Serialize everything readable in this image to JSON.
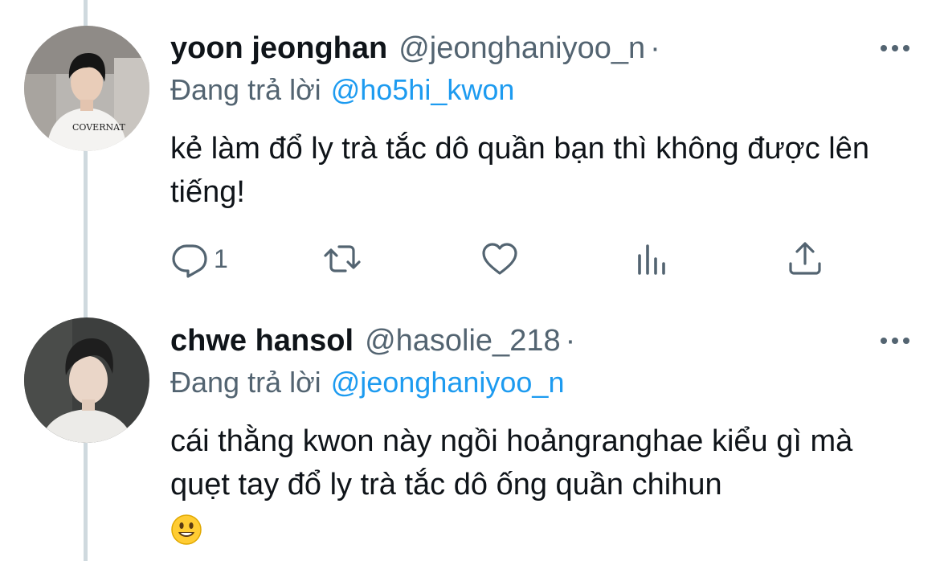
{
  "tweets": [
    {
      "display_name": "yoon jeonghan",
      "handle": "@jeonghaniyoo_n",
      "separator": "·",
      "reply_prefix": "Đang trả lời",
      "reply_to": "@ho5hi_kwon",
      "text": "kẻ làm đổ ly trà tắc dô quần bạn thì không được lên tiếng!",
      "reply_count": "1",
      "avatar_print": "COVERNAT"
    },
    {
      "display_name": "chwe hansol",
      "handle": "@hasolie_218",
      "separator": "·",
      "reply_prefix": "Đang trả lời",
      "reply_to": "@jeonghaniyoo_n",
      "text": "cái thằng kwon này ngồi hoảngranghae kiểu gì mà quẹt tay đổ ly trà tắc dô ống quần chihun",
      "emoji": "smiling-face-emoji"
    }
  ],
  "colors": {
    "text": "#0f1419",
    "secondary": "#536471",
    "link": "#1d9bf0",
    "thread_line": "#cfd9de"
  },
  "icons": [
    "reply-icon",
    "retweet-icon",
    "like-icon",
    "analytics-icon",
    "share-icon",
    "more-icon"
  ]
}
